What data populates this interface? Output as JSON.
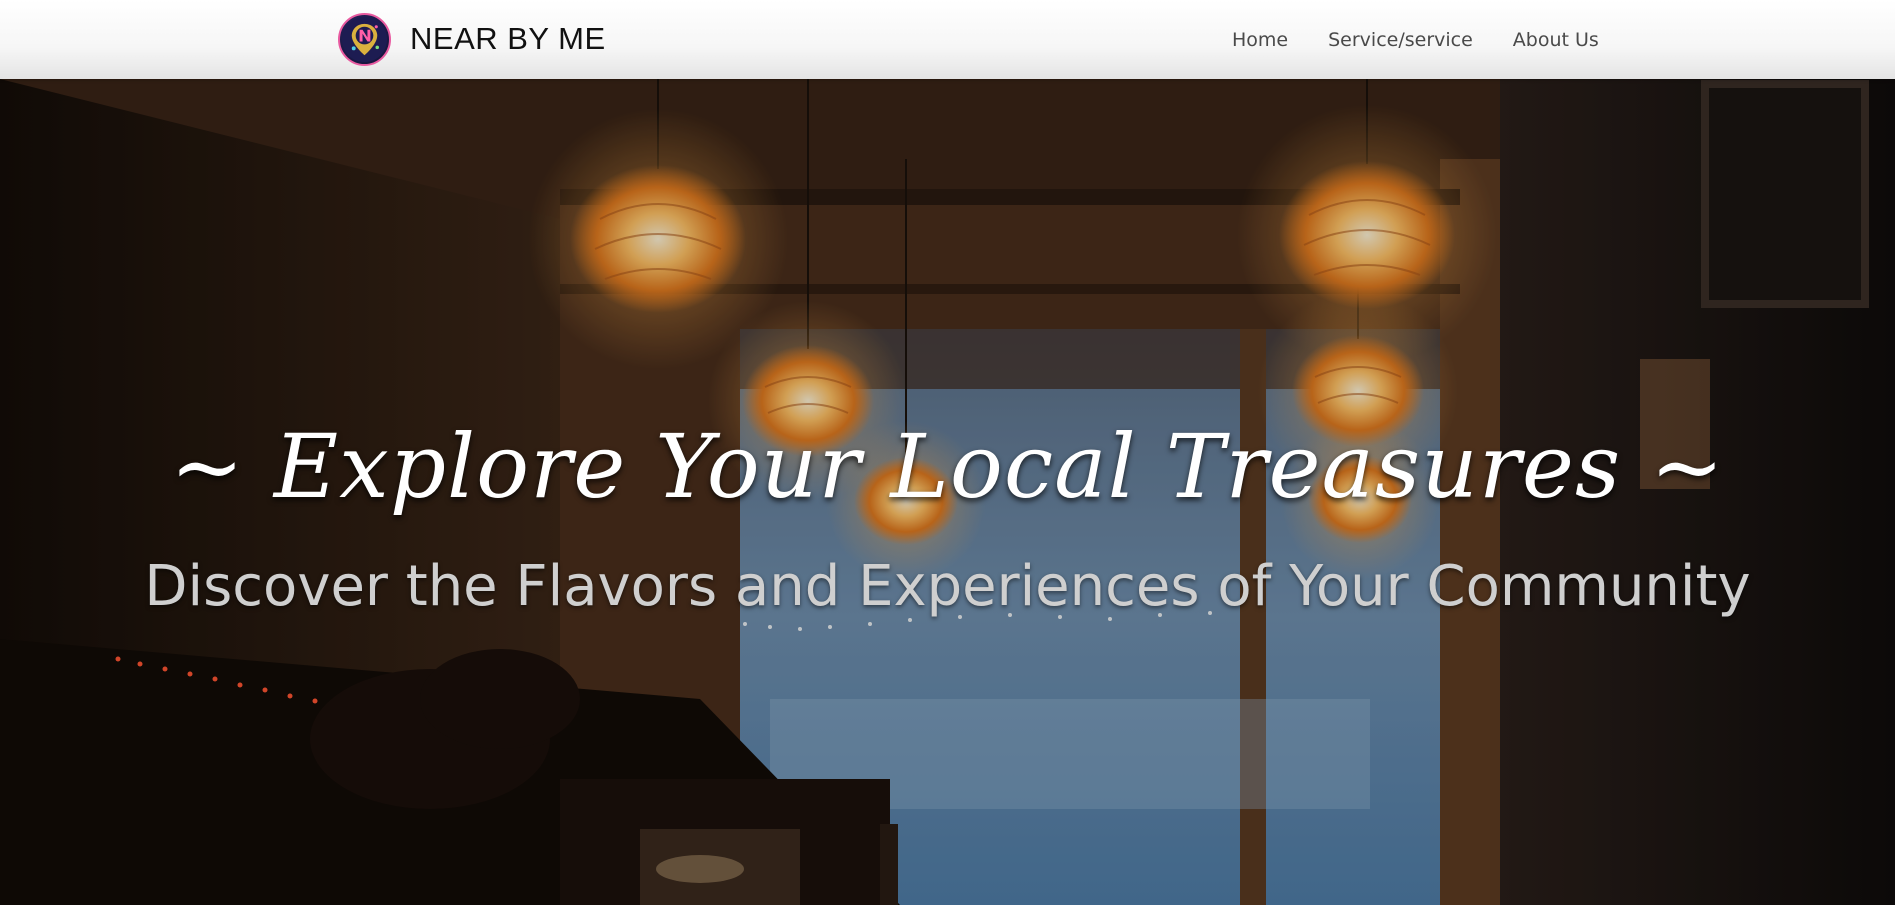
{
  "navbar": {
    "brand_name": "NEAR BY ME",
    "logo_icon": "location-pin-logo-icon",
    "links": [
      {
        "label": "Home"
      },
      {
        "label": "Service/service"
      },
      {
        "label": "About Us"
      }
    ]
  },
  "hero": {
    "title": "~ Explore Your Local Treasures ~",
    "subtitle": "Discover the Flavors and Experiences of Your Community",
    "background_image": "cafe-interior-with-pendant-lamps"
  },
  "colors": {
    "nav_background": "#ffffff",
    "nav_text": "#4a4a4a",
    "brand_text": "#111111",
    "hero_title": "#ffffff",
    "hero_subtitle": "#cfcfcf",
    "lamp_glow": "#ffb347"
  }
}
